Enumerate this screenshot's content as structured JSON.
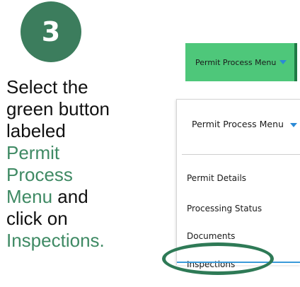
{
  "step": {
    "number": "3"
  },
  "instructions": {
    "line1": "Select the",
    "line2": "green button",
    "line3": "labeled",
    "line4": "Permit",
    "line5": "Process",
    "line6_green": "Menu",
    "line6_black": " and",
    "line7": "click on",
    "line8": "Inspections."
  },
  "menu_button": {
    "label": "Permit Process Menu",
    "icon": "caret-down-icon"
  },
  "dropdown": {
    "header_label": "Permit Process Menu",
    "items": [
      {
        "label": "Permit Details"
      },
      {
        "label": "Processing Status"
      },
      {
        "label": "Documents"
      },
      {
        "label": "Inspections"
      }
    ]
  },
  "colors": {
    "circle": "#3c7d5d",
    "accent_text": "#3f8a64",
    "button_green": "#4ec77a",
    "caret_blue": "#2b8ad6",
    "highlight": "#2e7a56"
  }
}
